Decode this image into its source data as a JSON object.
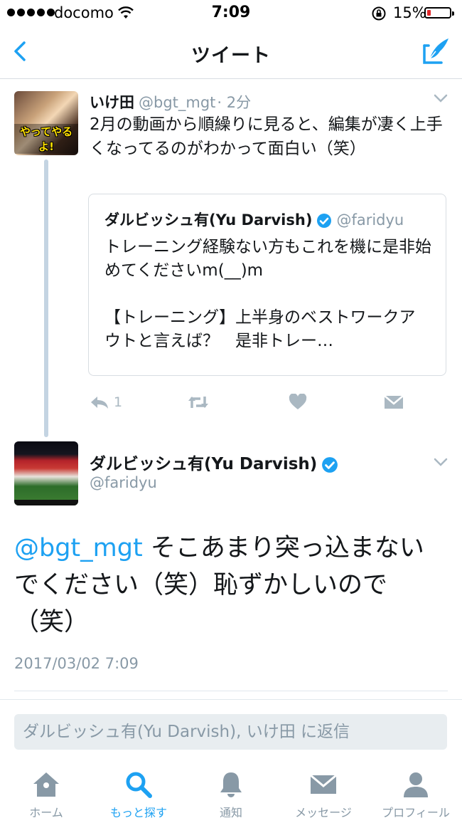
{
  "status_bar": {
    "carrier": "docomo",
    "time": "7:09",
    "battery": "15%",
    "battery_level": 0.15
  },
  "nav": {
    "title": "ツイート",
    "back_icon": "chevron-left-icon",
    "compose_icon": "compose-tweet-icon"
  },
  "tweet1": {
    "name": "いけ田",
    "handle": "@bgt_mgt",
    "time": "· 2分",
    "avatar_caption": "やってやるよ!",
    "text": "2月の動画から順繰りに見ると、編集が凄く上手くなってるのがわかって面白い（笑）",
    "quote": {
      "name": "ダルビッシュ有(Yu Darvish)",
      "handle": "@faridyu",
      "line1": "トレーニング経験ない方もこれを機に是非始めてくださいm(__)m",
      "line2": "【トレーニング】上半身のベストワークアウトと言えば？　是非トレー…"
    },
    "actions": {
      "reply_count": "1"
    }
  },
  "tweet2": {
    "name": "ダルビッシュ有(Yu Darvish)",
    "handle": "@faridyu",
    "mention": "@bgt_mgt",
    "text": "そこあまり突っ込まないでください（笑）恥ずかしいので（笑）",
    "timestamp": "2017/03/02 7:09"
  },
  "reply": {
    "placeholder": "ダルビッシュ有(Yu Darvish), いけ田 に返信"
  },
  "tabs": [
    {
      "label": "ホーム",
      "icon": "home-icon"
    },
    {
      "label": "もっと探す",
      "icon": "search-icon"
    },
    {
      "label": "通知",
      "icon": "bell-icon"
    },
    {
      "label": "メッセージ",
      "icon": "envelope-icon"
    },
    {
      "label": "プロフィール",
      "icon": "person-icon"
    }
  ],
  "colors": {
    "accent": "#1da1f2",
    "muted": "#8899a6",
    "text": "#14171a"
  }
}
